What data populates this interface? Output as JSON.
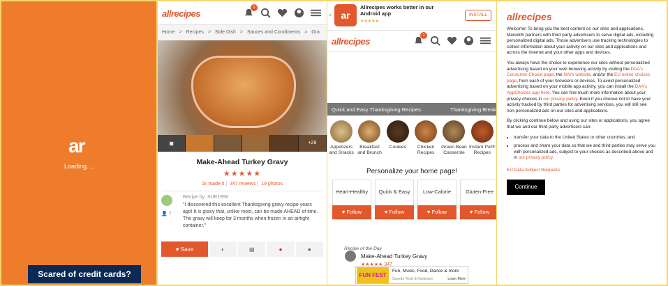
{
  "panel1": {
    "logo": "ar",
    "loading_text": "Loading...."
  },
  "panel2": {
    "brand": "allrecipes",
    "notif_count": "1",
    "breadcrumbs": [
      "Home",
      ">",
      "Recipes",
      ">",
      "Side Dish",
      ">",
      "Sauces and Condiments",
      ">",
      "Gra"
    ],
    "photo_count": "+29",
    "recipe_title": "Make-Ahead Turkey Gravy",
    "stars": "★★★★★",
    "made_it": "1k made it",
    "reviews": "347 reviews",
    "photos": "19 photos",
    "recipe_by": "Recipe by: SUE1956",
    "quote": "\"I discovered this excellent Thanksgiving gravy recipe years ago! It is gravy that, unlike most, can be made AHEAD of time. The gravy will keep for 3 months when frozen in an airtight container.\"",
    "follower_count": "7",
    "save_label": "Save",
    "ad_text": "Scared of credit cards?"
  },
  "panel3": {
    "app_banner_title": "Allrecipes works better in our Android app",
    "app_stars": "★★★★★",
    "install_label": "INSTALL",
    "close": "×",
    "brand": "allrecipes",
    "notif_count": "1",
    "carousel_left": "Quick and Easy Thanksgiving Recipes",
    "carousel_right": "Thanksgiving Break",
    "categories": [
      "Appetizers and Snacks",
      "Breakfast and Brunch",
      "Cookies",
      "Chicken Recipes",
      "Green Bean Casserole",
      "Instant Pot® Recipes"
    ],
    "personalize_heading": "Personalize your home page!",
    "pref_cards": [
      {
        "label": "Heart-Healthy",
        "follow": "Follow"
      },
      {
        "label": "Quick & Easy",
        "follow": "Follow"
      },
      {
        "label": "Low-Calorie",
        "follow": "Follow"
      },
      {
        "label": "Gluten-Free",
        "follow": "Follow"
      }
    ],
    "rotd_label": "Recipe of the Day",
    "rotd_title": "Make-Ahead Turkey Gravy",
    "rotd_stars": "★★★★★ 347",
    "ad_brand": "FUN FEST",
    "ad_title": "Fun, Music, Food, Dance & more",
    "ad_sub": "Speedo Tools & Hardware",
    "ad_learn": "Learn More"
  },
  "panel4": {
    "brand": "allrecipes",
    "p1": "Welcome! To bring you the best content on our sites and applications, Meredith partners with third party advertisers to serve digital ads, including personalized digital ads. Those advertisers use tracking technologies to collect information about your activity on our sites and applications and across the Internet and your other apps and devices.",
    "p2a": "You always have the choice to experience our sites without personalized advertising based on your web browsing activity by visiting the ",
    "link_daa": "DAA's Consumer Choice page",
    "p2b": ", the ",
    "link_nai": "NAI's website",
    "p2c": ", and/or the ",
    "link_eu": "EU online choices page",
    "p2d": ", from each of your browsers or devices. To avoid personalized advertising based on your mobile app activity, you can install the ",
    "link_app": "DAA's AppChoices app here",
    "p2e": ". You can find much more information about your privacy choices in ",
    "link_privacy": "our privacy policy",
    "p2f": ". Even if you choose not to have your activity tracked by third parties for advertising services, you will still see non-personalized ads on our sites and applications.",
    "p3": "By clicking continue below and using our sites or applications, you agree that we and our third party advertisers can:",
    "bullet1": "transfer your data to the United States or other countries; and",
    "bullet2a": "process and share your data so that we and third parties may serve you with personalized ads, subject to your choices as described above and in ",
    "bullet2_link": "our privacy policy",
    "bullet2b": ".",
    "eu_link": "EU Data Subject Requests",
    "continue_label": "Continue"
  }
}
